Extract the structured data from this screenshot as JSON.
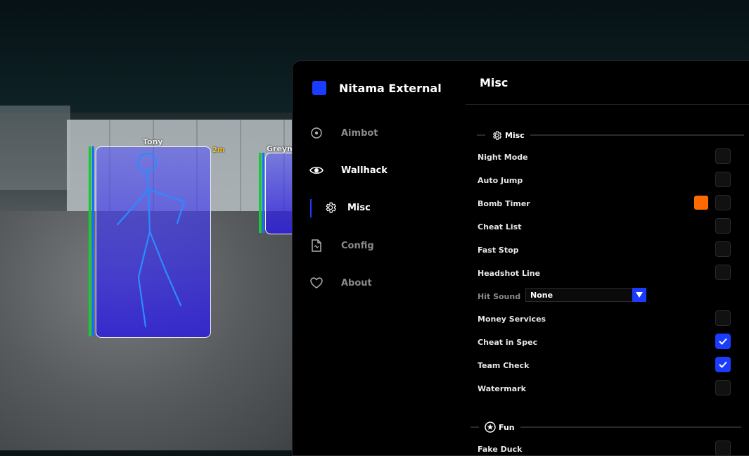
{
  "app": {
    "title": "Nitama External",
    "brand_color": "#1a3cff"
  },
  "esp": {
    "players": [
      {
        "name": "Tony",
        "distance": "2m"
      },
      {
        "name": "Greym"
      }
    ]
  },
  "sidebar": {
    "items": [
      {
        "label": "Aimbot",
        "icon": "target-icon"
      },
      {
        "label": "Wallhack",
        "icon": "eye-icon"
      },
      {
        "label": "Misc",
        "icon": "gear-icon"
      },
      {
        "label": "Config",
        "icon": "file-icon"
      },
      {
        "label": "About",
        "icon": "heart-icon"
      }
    ],
    "active": "Misc"
  },
  "content": {
    "title": "Misc",
    "sections": [
      {
        "label": "Misc",
        "icon": "gear-icon"
      },
      {
        "label": "Fun",
        "icon": "star-circle-icon"
      }
    ],
    "options": [
      {
        "label": "Night Mode",
        "checked": false
      },
      {
        "label": "Auto Jump",
        "checked": false
      },
      {
        "label": "Bomb Timer",
        "checked": false,
        "color": "#ff6a00"
      },
      {
        "label": "Cheat List",
        "checked": false
      },
      {
        "label": "Fast Stop",
        "checked": false
      },
      {
        "label": "Headshot Line",
        "checked": false
      },
      {
        "label": "Hit Sound",
        "type": "select",
        "value": "None"
      },
      {
        "label": "Money Services",
        "checked": false
      },
      {
        "label": "Cheat in Spec",
        "checked": true
      },
      {
        "label": "Team Check",
        "checked": true
      },
      {
        "label": "Watermark",
        "checked": false
      }
    ],
    "fun_options": [
      {
        "label": "Fake Duck",
        "checked": false
      }
    ]
  }
}
